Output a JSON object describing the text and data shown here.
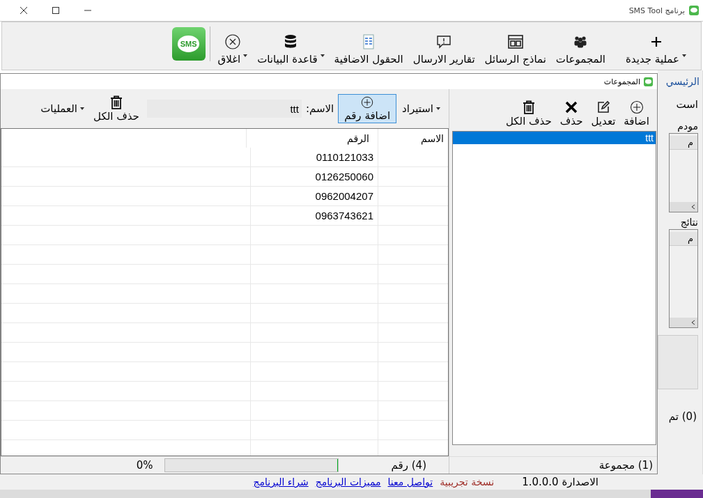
{
  "window": {
    "title": "برنامج SMS Tool"
  },
  "toolbar": {
    "items": [
      {
        "label": "عملية جديدة",
        "kind": "plus",
        "dropdown": true
      },
      {
        "label": "المجموعات",
        "kind": "people",
        "dropdown": false
      },
      {
        "label": "نماذج الرسائل",
        "kind": "template",
        "dropdown": false
      },
      {
        "label": "تقارير الارسال",
        "kind": "report",
        "dropdown": false
      },
      {
        "label": "الحقول الاضافية",
        "kind": "fields",
        "dropdown": false
      },
      {
        "label": "قاعدة البيانات",
        "kind": "database",
        "dropdown": true
      },
      {
        "label": "اغلاق",
        "kind": "close",
        "dropdown": true
      }
    ],
    "logo": "SMS"
  },
  "groups_window": {
    "title": "المجموعات",
    "groups_toolbar": [
      {
        "label": "اضافة",
        "kind": "add"
      },
      {
        "label": "تعديل",
        "kind": "edit"
      },
      {
        "label": "حذف",
        "kind": "delete"
      },
      {
        "label": "حذف الكل",
        "kind": "trash"
      }
    ],
    "groups": [
      {
        "name": "ttt",
        "selected": true
      }
    ],
    "groups_count": "(1) مجموعة",
    "numbers_toolbar": {
      "import": {
        "label": "استيراد",
        "dropdown": true
      },
      "add": {
        "label": "اضافة رقم",
        "highlighted": true
      },
      "name_label": "الاسم:",
      "name_value": "ttt",
      "delete_all": "حذف الكل",
      "operations": {
        "label": "العمليات",
        "dropdown": true
      }
    },
    "columns": [
      "الاسم",
      "الرقم"
    ],
    "rows": [
      {
        "number": "0110121033"
      },
      {
        "number": "0126250060"
      },
      {
        "number": "0962004207"
      },
      {
        "number": "0963743621"
      }
    ],
    "numbers_count": "(4) رقم",
    "progress": {
      "level": 0,
      "reading": "0%"
    }
  },
  "background_window": {
    "tab": "الرئيسي",
    "section": "است",
    "modem_label": "مودم",
    "modem_column": "م",
    "results_label": "نتائج",
    "results_column": "م",
    "sent_count": "(0) تم"
  },
  "status_bar": {
    "version": "الاصدارة 1.0.0.0",
    "edition": "نسخة تجريبية",
    "links": [
      "تواصل معنا",
      "مميزات البرنامج",
      "شراء البرنامج"
    ]
  }
}
